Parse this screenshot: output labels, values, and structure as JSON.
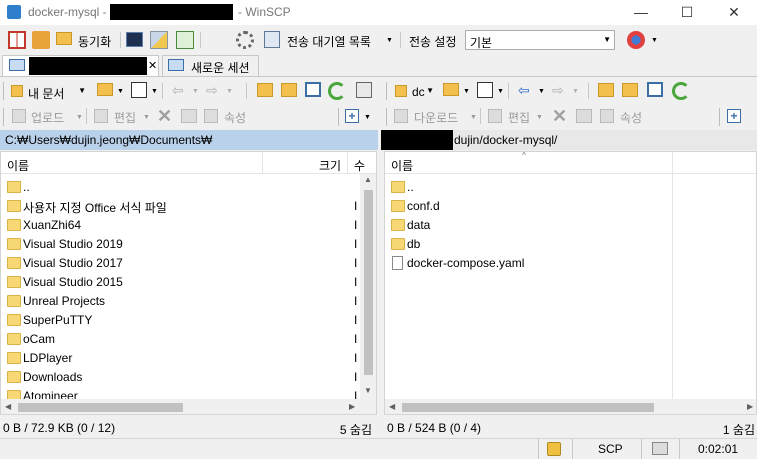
{
  "window": {
    "title_prefix": "docker-mysql -",
    "title_suffix": "- WinSCP",
    "minimize": "—",
    "maximize": "☐",
    "close": "✕"
  },
  "toolbar1": {
    "sync_label": "동기화",
    "queue_label": "전송 대기열 목록",
    "transfer_settings_label": "전송 설정",
    "transfer_preset": "기본"
  },
  "tabs": {
    "new_session": "새로운 세션",
    "close_glyph": "✕"
  },
  "left": {
    "location": "내 문서",
    "upload_label": "업로드",
    "edit_label": "편집",
    "properties_label": "속성",
    "path": "C:₩Users₩dujin.jeong₩Documents₩",
    "col_name": "이름",
    "col_size": "크기",
    "col_extra": "수",
    "files": [
      {
        "name": "..",
        "type": "up",
        "mark": ""
      },
      {
        "name": "사용자 지정 Office 서식 파일",
        "type": "folder",
        "mark": "I"
      },
      {
        "name": "XuanZhi64",
        "type": "folder",
        "mark": "I"
      },
      {
        "name": "Visual Studio 2019",
        "type": "folder",
        "mark": "I"
      },
      {
        "name": "Visual Studio 2017",
        "type": "folder",
        "mark": "I"
      },
      {
        "name": "Visual Studio 2015",
        "type": "folder",
        "mark": "I"
      },
      {
        "name": "Unreal Projects",
        "type": "folder",
        "mark": "I"
      },
      {
        "name": "SuperPuTTY",
        "type": "folder",
        "mark": "I"
      },
      {
        "name": "oCam",
        "type": "folder",
        "mark": "I"
      },
      {
        "name": "LDPlayer",
        "type": "folder",
        "mark": "I"
      },
      {
        "name": "Downloads",
        "type": "folder",
        "mark": "I"
      },
      {
        "name": "Atomineer",
        "type": "folder",
        "mark": "I"
      }
    ],
    "status_size": "0 B / 72.9 KB (0 / 12)",
    "status_hidden": "5 숨김"
  },
  "right": {
    "location": "dc",
    "download_label": "다운로드",
    "edit_label": "편집",
    "properties_label": "속성",
    "path": "dujin/docker-mysql/",
    "col_name": "이름",
    "files": [
      {
        "name": "..",
        "type": "up"
      },
      {
        "name": "conf.d",
        "type": "folder"
      },
      {
        "name": "data",
        "type": "folder"
      },
      {
        "name": "db",
        "type": "folder"
      },
      {
        "name": "docker-compose.yaml",
        "type": "file"
      }
    ],
    "status_size": "0 B / 524 B (0 / 4)",
    "status_hidden": "1 숨김"
  },
  "statusbar": {
    "protocol": "SCP",
    "elapsed": "0:02:01"
  },
  "colors": {
    "path_bar_active": "#b9d1ea",
    "folder": "#f8d775"
  }
}
